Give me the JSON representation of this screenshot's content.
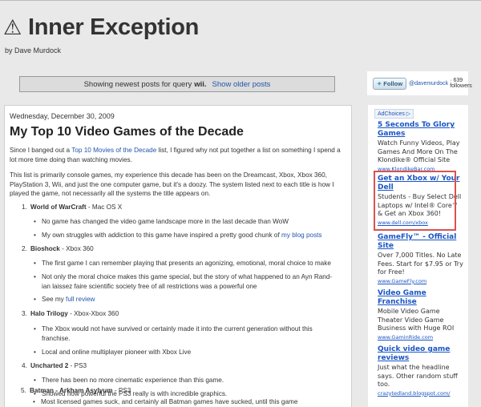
{
  "header": {
    "warn_glyph": "⚠",
    "title": "Inner Exception",
    "byline": "by Dave Murdock"
  },
  "status_bar": {
    "prefix": "Showing newest posts for query",
    "query": "wii.",
    "older_link": "Show older posts"
  },
  "follow": {
    "button_label": "Follow",
    "handle": "@davemurdock",
    "followers": "· 639 followers"
  },
  "post": {
    "date": "Wednesday, December 30, 2009",
    "title": "My Top 10 Video Games of the Decade",
    "p1_before": "Since I banged out a ",
    "p1_link": "Top 10 Movies of the Decade",
    "p1_after": " list, I figured why not put together a list on something I spend a lot more time doing than watching movies.",
    "p2": "This list is primarily console games, my experience this decade has been on the Dreamcast, Xbox, Xbox 360, PlayStation 3, Wii, and just the one computer game, but it's a doozy. The system listed next to each title is how I played the game, not necessarily all the systems the title appears on.",
    "items": [
      {
        "num": "1.",
        "name": "World of WarCraft",
        "platform": " - Mac OS X",
        "bullets": [
          {
            "text": "No game has changed the video game landscape more in the last decade than WoW"
          },
          {
            "text": "My own struggles with addiction to this game have inspired a pretty good chunk of ",
            "link": "my blog posts"
          }
        ]
      },
      {
        "num": "2.",
        "name": "Bioshock",
        "platform": " - Xbox 360",
        "bullets": [
          {
            "text": "The first game I can remember playing that presents an agonizing, emotional, moral choice to make"
          },
          {
            "text": "Not only the moral choice makes this game special, but the story of what happened to an Ayn Rand-ian laissez faire scientific society free of all restrictions was a powerful one"
          },
          {
            "text": "See my ",
            "link": "full review"
          }
        ]
      },
      {
        "num": "3.",
        "name": "Halo Trilogy",
        "platform": " - Xbox-Xbox 360",
        "bullets": [
          {
            "text": "The Xbox would not have survived or certainly made it into the current generation without this franchise."
          },
          {
            "text": "Local and online multiplayer pioneer with Xbox Live"
          }
        ]
      },
      {
        "num": "4.",
        "name": "Uncharted 2",
        "platform": " - PS3",
        "bullets": [
          {
            "text": "There has been no more cinematic experience than this game."
          },
          {
            "text": "Showed how powerful the PS3 really is with incredible graphics."
          }
        ]
      },
      {
        "num": "5.",
        "name": "Batman - Arkham Asylyum",
        "platform": " - PS3",
        "bullets": [
          {
            "text": "Most licensed games suck, and certainly all Batman games have sucked, until this game"
          }
        ]
      }
    ]
  },
  "sidebar": {
    "adchoices": "AdChoices ▷",
    "ads": [
      {
        "title": "5 Seconds To Glory Games",
        "body": "Watch Funny Videos, Play Games And More On The Klondike® Official Site",
        "url": "www.KlondikeBar.com"
      },
      {
        "title": "Get an Xbox w/ Your Dell",
        "body": "Students - Buy Select Dell Laptops w/ Intel® Core™ & Get an Xbox 360!",
        "url": "www.dell.com/xbox"
      },
      {
        "title": "GameFly™ - Official Site",
        "body": "Over 7,000 Titles. No Late Fees. Start for $7.95 or Try for Free!",
        "url": "www.GameFly.com"
      },
      {
        "title": "Video Game Franchise",
        "body": "Mobile Video Game Theater Video Game Business with Huge ROI",
        "url": "www.GaminRide.com"
      },
      {
        "title": "Quick video game reviews",
        "body": "Just what the headline says. Other random stuff too.",
        "url": "crazytedland.blogspot.com/"
      }
    ]
  },
  "colors": {
    "link": "#2255aa",
    "ad_link": "#1a55c4",
    "highlight": "#d9534f",
    "page_bg": "#e9e9e9"
  }
}
